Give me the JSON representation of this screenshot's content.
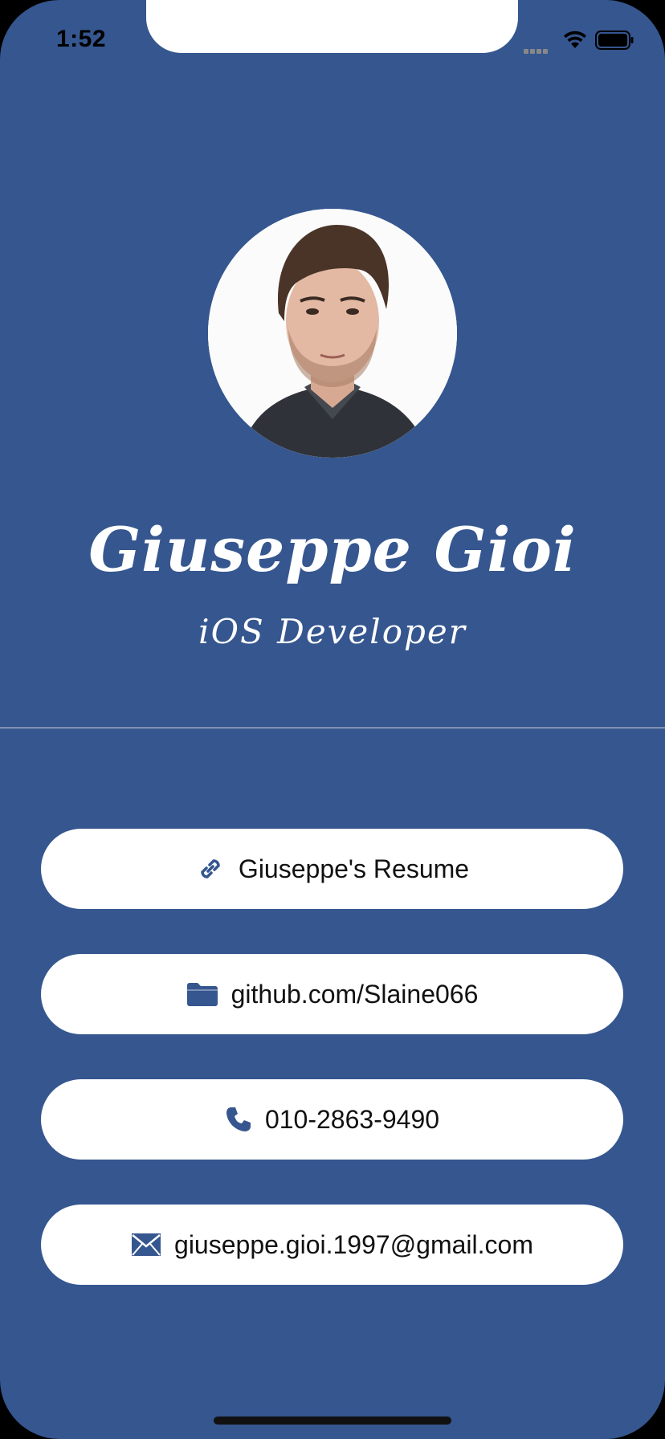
{
  "status_bar": {
    "time": "1:52"
  },
  "profile": {
    "name": "Giuseppe Gioi",
    "role": "iOS Developer",
    "photo_icon": "profile-photo"
  },
  "links": [
    {
      "label": "Giuseppe's Resume",
      "icon": "link-icon"
    },
    {
      "label": "github.com/Slaine066",
      "icon": "folder-icon"
    },
    {
      "label": "010-2863-9490",
      "icon": "phone-icon"
    },
    {
      "label": "giuseppe.gioi.1997@gmail.com",
      "icon": "envelope-icon"
    }
  ],
  "colors": {
    "background": "#35568f",
    "button": "#ffffff",
    "icon_accent": "#35568f"
  }
}
